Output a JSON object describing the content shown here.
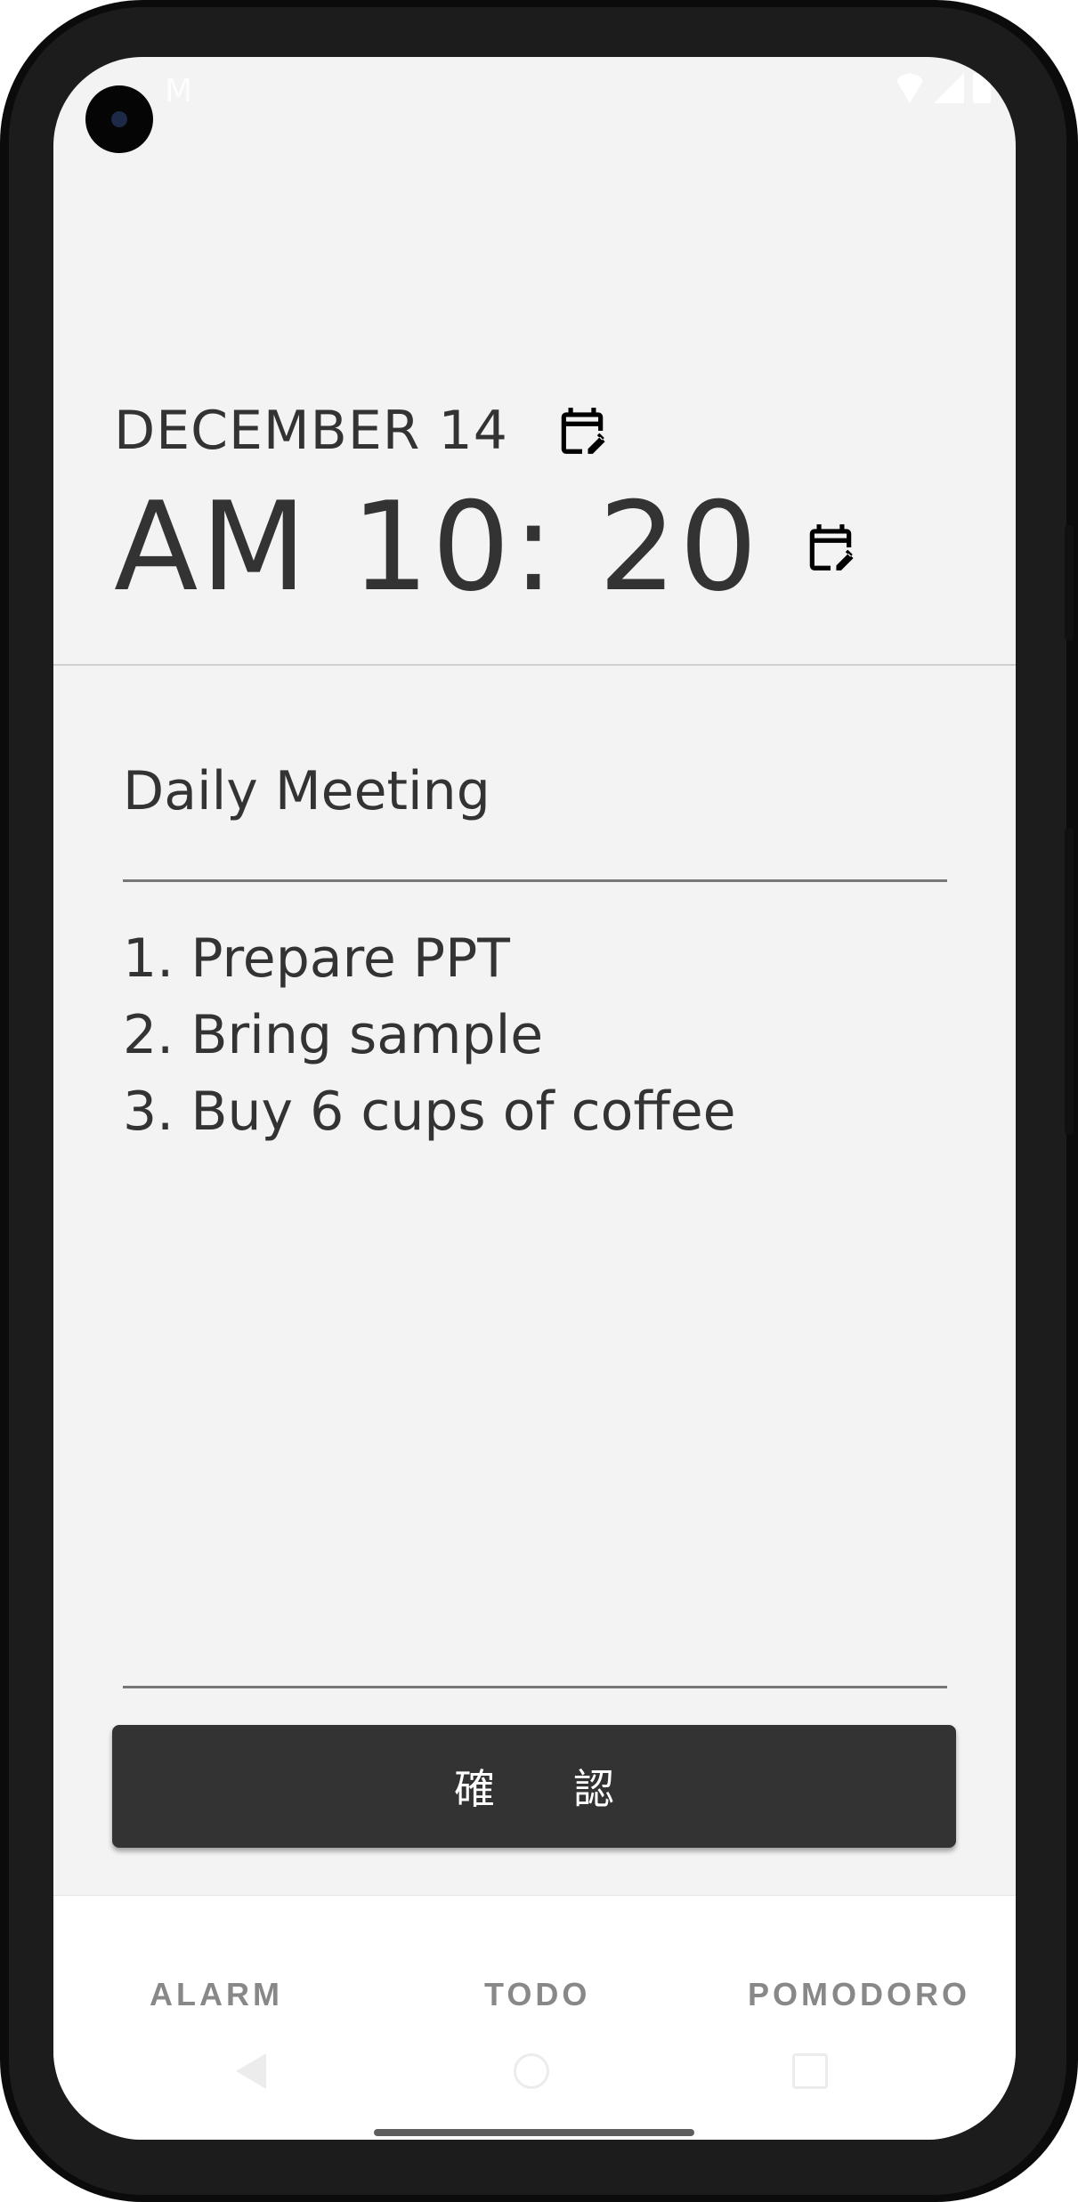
{
  "status_bar": {
    "notification_icon_text": "M"
  },
  "header": {
    "date": "DECEMBER 14",
    "time": "AM 10: 20"
  },
  "form": {
    "title_value": "Daily Meeting",
    "note_lines": [
      "1. Prepare PPT",
      "2. Bring sample",
      "3. Buy 6 cups of coffee"
    ],
    "confirm_label": "確認"
  },
  "bottom_nav": {
    "items": [
      {
        "label": "ALARM"
      },
      {
        "label": "TODO"
      },
      {
        "label": "POMODORO"
      }
    ]
  },
  "icons": {
    "date_edit": "calendar-edit-icon",
    "time_edit": "calendar-edit-icon",
    "system_back": "back-icon",
    "system_home": "home-icon",
    "system_recent": "recent-apps-icon"
  },
  "colors": {
    "text": "#333333",
    "background": "#f3f3f3",
    "button": "#333333",
    "nav_label": "#888888"
  }
}
